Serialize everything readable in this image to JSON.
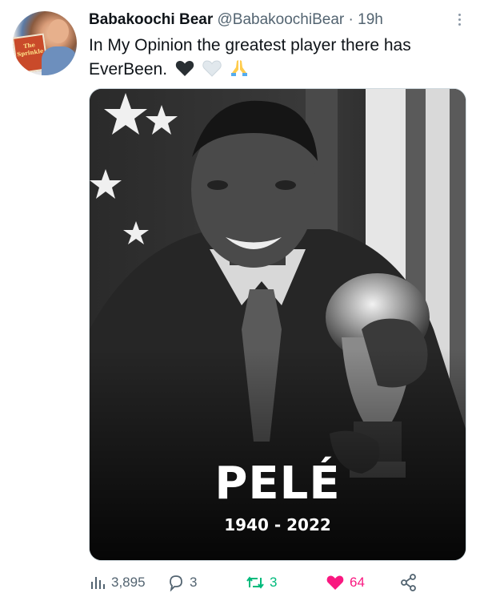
{
  "tweet": {
    "author_name": "Babakoochi Bear",
    "handle": "@BabakoochiBear",
    "separator": "·",
    "time": "19h",
    "text": "In My Opinion the greatest player there has EverBeen.",
    "emojis": [
      "black-heart",
      "white-heart",
      "folded-hands"
    ],
    "avatar_book_title": "The Sprinkle"
  },
  "media": {
    "overlay_name": "PELÉ",
    "overlay_years": "1940 - 2022"
  },
  "stats": {
    "views": "3,895",
    "replies": "3",
    "retweets": "3",
    "likes": "64"
  },
  "colors": {
    "retweet": "#00ba7c",
    "like": "#f91880",
    "muted": "#536471"
  }
}
